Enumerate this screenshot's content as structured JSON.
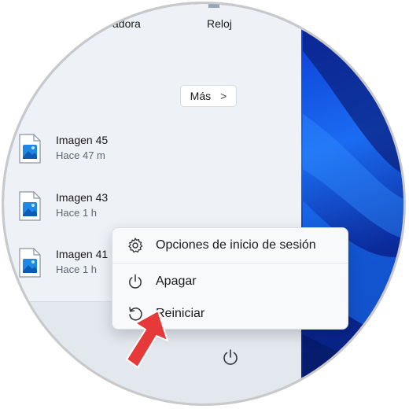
{
  "pinned": {
    "left_label": "adora",
    "right_label": "Reloj"
  },
  "more_button": {
    "label": "Más",
    "icon": "chevron-right-icon"
  },
  "recent": [
    {
      "title": "Imagen 45",
      "time": "Hace 47 m",
      "icon": "image-file-icon"
    },
    {
      "title": "Imagen 43",
      "time": "Hace 1 h",
      "icon": "image-file-icon"
    },
    {
      "title": "Imagen 41",
      "time": "Hace 1 h",
      "icon": "image-file-icon"
    }
  ],
  "power_menu": {
    "items": [
      {
        "label": "Opciones de inicio de sesión",
        "icon": "gear-icon"
      },
      {
        "label": "Apagar",
        "icon": "power-icon"
      },
      {
        "label": "Reiniciar",
        "icon": "restart-icon"
      }
    ]
  },
  "footer": {
    "icon": "power-icon"
  },
  "colors": {
    "arrow": "#e63a3a",
    "panel": "#eef1f6",
    "wallpaper": "#0d3fd6",
    "file_icon_blue": "#1e88e5"
  }
}
